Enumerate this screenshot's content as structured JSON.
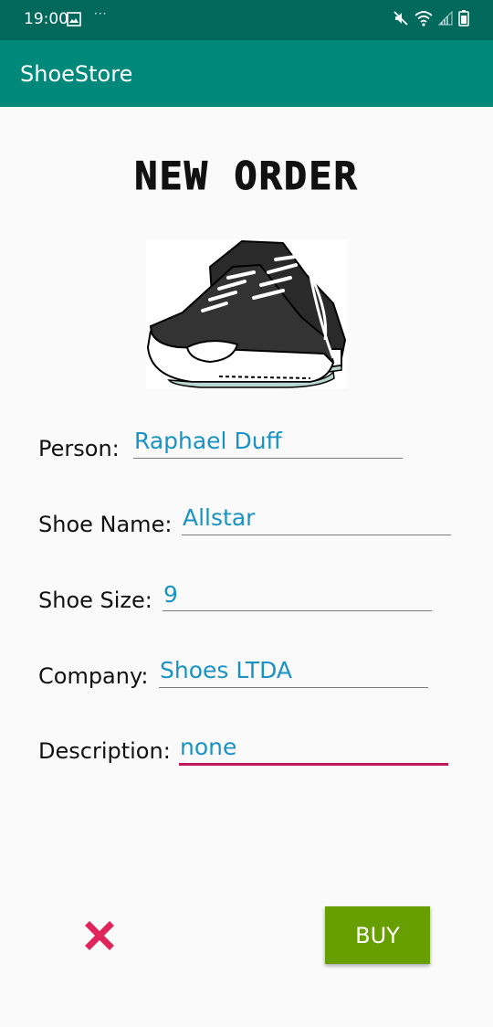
{
  "status_bar": {
    "time": "19:00",
    "dots": "···",
    "icons": [
      "image-icon",
      "mute-icon",
      "wifi-icon",
      "signal-icon",
      "battery-icon"
    ]
  },
  "app_bar": {
    "title": "ShoeStore",
    "color": "#00897b"
  },
  "page": {
    "heading": "NEW ORDER",
    "image": "sneakers-image"
  },
  "form": {
    "fields": [
      {
        "label": "Person:",
        "value": "Raphael Duff"
      },
      {
        "label": "Shoe Name:",
        "value": "Allstar"
      },
      {
        "label": "Shoe Size:",
        "value": "9"
      },
      {
        "label": "Company:",
        "value": "Shoes LTDA"
      },
      {
        "label": "Description:",
        "value": "none"
      }
    ]
  },
  "actions": {
    "cancel_icon": "close-icon",
    "buy_label": "BUY",
    "buy_color": "#689f00",
    "cancel_color": "#e0245e"
  }
}
